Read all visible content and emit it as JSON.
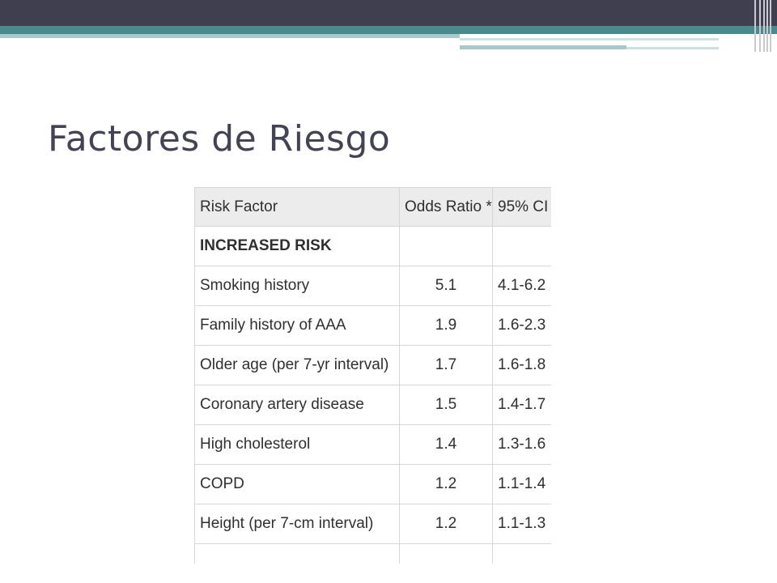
{
  "slide": {
    "title": "Factores de Riesgo"
  },
  "colors": {
    "header_band": "#3f3f50",
    "teal_band": "#4b8a8c",
    "teal_light": "#a9c8c9",
    "title_text": "#444355",
    "table_header_bg": "#ececec",
    "table_border": "#d6d6d6"
  },
  "table": {
    "headers": [
      "Risk Factor",
      "Odds Ratio *",
      "95% CI"
    ],
    "section_label": "INCREASED RISK",
    "rows": [
      {
        "factor": "Smoking history",
        "odds_ratio": "5.1",
        "ci": "4.1-6.2"
      },
      {
        "factor": "Family history of AAA",
        "odds_ratio": "1.9",
        "ci": "1.6-2.3"
      },
      {
        "factor": "Older age (per 7-yr interval)",
        "odds_ratio": "1.7",
        "ci": "1.6-1.8"
      },
      {
        "factor": "Coronary artery disease",
        "odds_ratio": "1.5",
        "ci": "1.4-1.7"
      },
      {
        "factor": "High cholesterol",
        "odds_ratio": "1.4",
        "ci": "1.3-1.6"
      },
      {
        "factor": "COPD",
        "odds_ratio": "1.2",
        "ci": "1.1-1.4"
      },
      {
        "factor": "Height (per 7-cm interval)",
        "odds_ratio": "1.2",
        "ci": "1.1-1.3"
      }
    ]
  }
}
